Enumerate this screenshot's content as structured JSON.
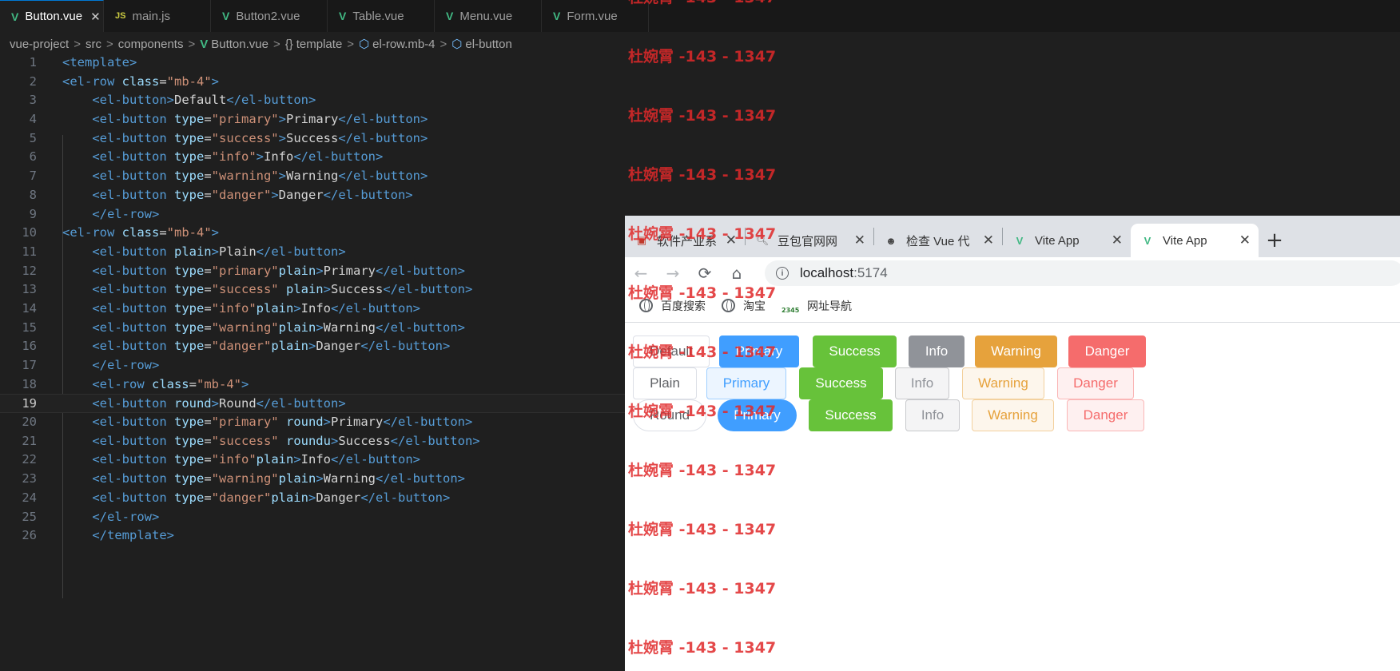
{
  "editor": {
    "tabs": [
      {
        "icon": "vue-file-icon",
        "glyph": "V",
        "label": "Button.vue",
        "active": true,
        "close": "✕"
      },
      {
        "icon": "js-file-icon",
        "glyph": "JS",
        "label": "main.js"
      },
      {
        "icon": "vue-file-icon",
        "glyph": "V",
        "label": "Button2.vue"
      },
      {
        "icon": "vue-file-icon",
        "glyph": "V",
        "label": "Table.vue"
      },
      {
        "icon": "vue-file-icon",
        "glyph": "V",
        "label": "Menu.vue"
      },
      {
        "icon": "vue-file-icon",
        "glyph": "V",
        "label": "Form.vue"
      }
    ],
    "breadcrumb": [
      "vue-project",
      "src",
      "components",
      "Button.vue",
      "template",
      "el-row.mb-4",
      "el-button"
    ],
    "breadcrumb_icons": {
      "vue": "V",
      "braces": "{}",
      "cube": "⬡"
    },
    "current_line": 19,
    "lines": [
      {
        "n": "1",
        "indent": "",
        "parts": [
          [
            "t",
            "<template>"
          ]
        ]
      },
      {
        "n": "2",
        "indent": "",
        "parts": [
          [
            "t",
            "<el-row "
          ],
          [
            "a",
            "class"
          ],
          [
            "x",
            "="
          ],
          [
            "s",
            "\"mb-4\""
          ],
          [
            "t",
            ">"
          ]
        ]
      },
      {
        "n": "3",
        "indent": "    ",
        "parts": [
          [
            "t",
            "<el-button"
          ],
          [
            "t",
            ">"
          ],
          [
            "x",
            "Default"
          ],
          [
            "t",
            "</el-button>"
          ]
        ]
      },
      {
        "n": "4",
        "indent": "    ",
        "parts": [
          [
            "t",
            "<el-button "
          ],
          [
            "a",
            "type"
          ],
          [
            "x",
            "="
          ],
          [
            "s",
            "\"primary\""
          ],
          [
            "t",
            ">"
          ],
          [
            "x",
            "Primary"
          ],
          [
            "t",
            "</el-button>"
          ]
        ]
      },
      {
        "n": "5",
        "indent": "    ",
        "parts": [
          [
            "t",
            "<el-button "
          ],
          [
            "a",
            "type"
          ],
          [
            "x",
            "="
          ],
          [
            "s",
            "\"success\""
          ],
          [
            "t",
            ">"
          ],
          [
            "x",
            "Success"
          ],
          [
            "t",
            "</el-button>"
          ]
        ]
      },
      {
        "n": "6",
        "indent": "    ",
        "parts": [
          [
            "t",
            "<el-button "
          ],
          [
            "a",
            "type"
          ],
          [
            "x",
            "="
          ],
          [
            "s",
            "\"info\""
          ],
          [
            "t",
            ">"
          ],
          [
            "x",
            "Info"
          ],
          [
            "t",
            "</el-button>"
          ]
        ]
      },
      {
        "n": "7",
        "indent": "    ",
        "parts": [
          [
            "t",
            "<el-button "
          ],
          [
            "a",
            "type"
          ],
          [
            "x",
            "="
          ],
          [
            "s",
            "\"warning\""
          ],
          [
            "t",
            ">"
          ],
          [
            "x",
            "Warning"
          ],
          [
            "t",
            "</el-button>"
          ]
        ]
      },
      {
        "n": "8",
        "indent": "    ",
        "parts": [
          [
            "t",
            "<el-button "
          ],
          [
            "a",
            "type"
          ],
          [
            "x",
            "="
          ],
          [
            "s",
            "\"danger\""
          ],
          [
            "t",
            ">"
          ],
          [
            "x",
            "Danger"
          ],
          [
            "t",
            "</el-button>"
          ]
        ]
      },
      {
        "n": "9",
        "indent": "    ",
        "parts": [
          [
            "t",
            "</el-row>"
          ]
        ]
      },
      {
        "n": "10",
        "indent": "",
        "parts": [
          [
            "t",
            "<el-row "
          ],
          [
            "a",
            "class"
          ],
          [
            "x",
            "="
          ],
          [
            "s",
            "\"mb-4\""
          ],
          [
            "t",
            ">"
          ]
        ]
      },
      {
        "n": "11",
        "indent": "    ",
        "parts": [
          [
            "t",
            "<el-button "
          ],
          [
            "a",
            "plain"
          ],
          [
            "t",
            ">"
          ],
          [
            "x",
            "Plain"
          ],
          [
            "t",
            "</el-button>"
          ]
        ]
      },
      {
        "n": "12",
        "indent": "    ",
        "parts": [
          [
            "t",
            "<el-button "
          ],
          [
            "a",
            "type"
          ],
          [
            "x",
            "="
          ],
          [
            "s",
            "\"primary\""
          ],
          [
            "a",
            "plain"
          ],
          [
            "t",
            ">"
          ],
          [
            "x",
            "Primary"
          ],
          [
            "t",
            "</el-button>"
          ]
        ]
      },
      {
        "n": "13",
        "indent": "    ",
        "parts": [
          [
            "t",
            "<el-button "
          ],
          [
            "a",
            "type"
          ],
          [
            "x",
            "="
          ],
          [
            "s",
            "\"success\" "
          ],
          [
            "a",
            "plain"
          ],
          [
            "t",
            ">"
          ],
          [
            "x",
            "Success"
          ],
          [
            "t",
            "</el-button>"
          ]
        ]
      },
      {
        "n": "14",
        "indent": "    ",
        "parts": [
          [
            "t",
            "<el-button "
          ],
          [
            "a",
            "type"
          ],
          [
            "x",
            "="
          ],
          [
            "s",
            "\"info\""
          ],
          [
            "a",
            "plain"
          ],
          [
            "t",
            ">"
          ],
          [
            "x",
            "Info"
          ],
          [
            "t",
            "</el-button>"
          ]
        ]
      },
      {
        "n": "15",
        "indent": "    ",
        "parts": [
          [
            "t",
            "<el-button "
          ],
          [
            "a",
            "type"
          ],
          [
            "x",
            "="
          ],
          [
            "s",
            "\"warning\""
          ],
          [
            "a",
            "plain"
          ],
          [
            "t",
            ">"
          ],
          [
            "x",
            "Warning"
          ],
          [
            "t",
            "</el-button>"
          ]
        ]
      },
      {
        "n": "16",
        "indent": "    ",
        "parts": [
          [
            "t",
            "<el-button "
          ],
          [
            "a",
            "type"
          ],
          [
            "x",
            "="
          ],
          [
            "s",
            "\"danger\""
          ],
          [
            "a",
            "plain"
          ],
          [
            "t",
            ">"
          ],
          [
            "x",
            "Danger"
          ],
          [
            "t",
            "</el-button>"
          ]
        ]
      },
      {
        "n": "17",
        "indent": "    ",
        "parts": [
          [
            "t",
            "</el-row>"
          ]
        ]
      },
      {
        "n": "18",
        "indent": "    ",
        "parts": [
          [
            "t",
            "<el-row "
          ],
          [
            "a",
            "class"
          ],
          [
            "x",
            "="
          ],
          [
            "s",
            "\"mb-4\""
          ],
          [
            "t",
            ">"
          ]
        ]
      },
      {
        "n": "19",
        "indent": "    ",
        "parts": [
          [
            "t",
            "<el-button "
          ],
          [
            "a",
            "round"
          ],
          [
            "t",
            ">"
          ],
          [
            "x",
            "Round"
          ],
          [
            "t",
            "</el-button>"
          ]
        ]
      },
      {
        "n": "20",
        "indent": "    ",
        "parts": [
          [
            "t",
            "<el-button "
          ],
          [
            "a",
            "type"
          ],
          [
            "x",
            "="
          ],
          [
            "s",
            "\"primary\" "
          ],
          [
            "a",
            "round"
          ],
          [
            "t",
            ">"
          ],
          [
            "x",
            "Primary"
          ],
          [
            "t",
            "</el-button>"
          ]
        ]
      },
      {
        "n": "21",
        "indent": "    ",
        "parts": [
          [
            "t",
            "<el-button "
          ],
          [
            "a",
            "type"
          ],
          [
            "x",
            "="
          ],
          [
            "s",
            "\"success\" "
          ],
          [
            "a",
            "roundu"
          ],
          [
            "t",
            ">"
          ],
          [
            "x",
            "Success"
          ],
          [
            "t",
            "</el-button>"
          ]
        ]
      },
      {
        "n": "22",
        "indent": "    ",
        "parts": [
          [
            "t",
            "<el-button "
          ],
          [
            "a",
            "type"
          ],
          [
            "x",
            "="
          ],
          [
            "s",
            "\"info\""
          ],
          [
            "a",
            "plain"
          ],
          [
            "t",
            ">"
          ],
          [
            "x",
            "Info"
          ],
          [
            "t",
            "</el-button>"
          ]
        ]
      },
      {
        "n": "23",
        "indent": "    ",
        "parts": [
          [
            "t",
            "<el-button "
          ],
          [
            "a",
            "type"
          ],
          [
            "x",
            "="
          ],
          [
            "s",
            "\"warning\""
          ],
          [
            "a",
            "plain"
          ],
          [
            "t",
            ">"
          ],
          [
            "x",
            "Warning"
          ],
          [
            "t",
            "</el-button>"
          ]
        ]
      },
      {
        "n": "24",
        "indent": "    ",
        "parts": [
          [
            "t",
            "<el-button "
          ],
          [
            "a",
            "type"
          ],
          [
            "x",
            "="
          ],
          [
            "s",
            "\"danger\""
          ],
          [
            "a",
            "plain"
          ],
          [
            "t",
            ">"
          ],
          [
            "x",
            "Danger"
          ],
          [
            "t",
            "</el-button>"
          ]
        ]
      },
      {
        "n": "25",
        "indent": "    ",
        "parts": [
          [
            "t",
            "</el-row>"
          ]
        ]
      },
      {
        "n": "26",
        "indent": "    ",
        "parts": [
          [
            "t",
            "</template>"
          ]
        ]
      }
    ]
  },
  "browser": {
    "tabs": [
      {
        "icon": "page-icon",
        "label": "软件产业系",
        "close": "✕"
      },
      {
        "icon": "search-icon",
        "label": "豆包官网网",
        "close": "✕"
      },
      {
        "icon": "avatar-icon",
        "label": "检查 Vue 代",
        "close": "✕"
      },
      {
        "icon": "vue-logo-icon",
        "label": "Vite App",
        "close": "✕"
      },
      {
        "icon": "vue-logo-icon",
        "label": "Vite App",
        "close": "✕",
        "active": true
      }
    ],
    "new_tab": "+",
    "nav": {
      "back": "←",
      "forward": "→",
      "reload": "⟳",
      "home": "⌂"
    },
    "url_host": "localhost",
    "url_port": ":5174",
    "bookmarks": [
      {
        "icon": "globe-icon",
        "label": "百度搜索"
      },
      {
        "icon": "globe-icon",
        "label": "淘宝"
      },
      {
        "icon": "2345-icon",
        "label": "网址导航",
        "badge": "2345"
      }
    ],
    "button_rows": [
      [
        {
          "label": "Default",
          "style": "d-default"
        },
        {
          "label": "Primary",
          "style": "d-primary"
        },
        {
          "label": "Success",
          "style": "d-success"
        },
        {
          "label": "Info",
          "style": "d-info"
        },
        {
          "label": "Warning",
          "style": "d-warning"
        },
        {
          "label": "Danger",
          "style": "d-danger"
        }
      ],
      [
        {
          "label": "Plain",
          "style": "d-default"
        },
        {
          "label": "Primary",
          "style": "p-primary"
        },
        {
          "label": "Success",
          "style": "d-success"
        },
        {
          "label": "Info",
          "style": "p-info"
        },
        {
          "label": "Warning",
          "style": "p-warning"
        },
        {
          "label": "Danger",
          "style": "p-danger"
        }
      ],
      [
        {
          "label": "Round",
          "style": "d-default round"
        },
        {
          "label": "Primary",
          "style": "d-primary round"
        },
        {
          "label": "Success",
          "style": "d-success"
        },
        {
          "label": "Info",
          "style": "p-info"
        },
        {
          "label": "Warning",
          "style": "p-warning"
        },
        {
          "label": "Danger",
          "style": "p-danger"
        }
      ]
    ]
  },
  "watermark": {
    "text": "杜婉霄 -143 - 1347",
    "count": 12
  }
}
